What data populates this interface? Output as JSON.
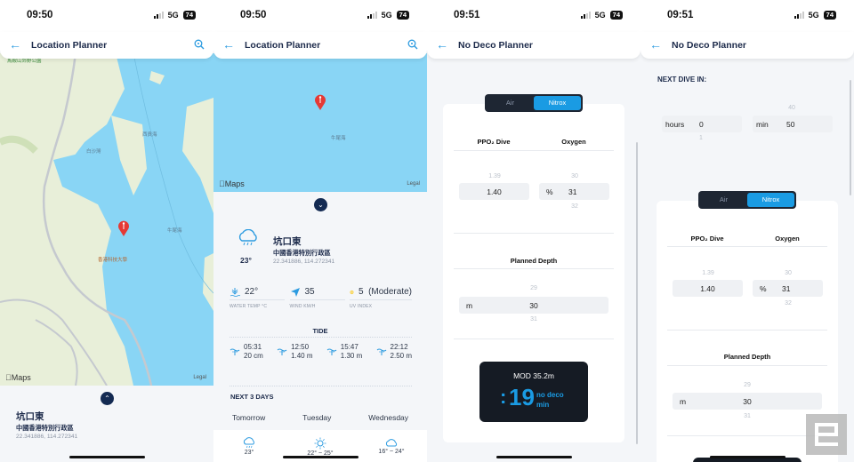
{
  "screens": [
    {
      "status": {
        "time": "09:50",
        "network": "5G",
        "battery": "74"
      },
      "header": {
        "title": "Location Planner"
      },
      "map": {
        "attribution": "Maps",
        "legal": "Legal",
        "labels": [
          "西貢海",
          "白沙灣",
          "牛尾海",
          "香港科技大學",
          "馬鞍山郊野公園"
        ]
      },
      "location": {
        "name": "坑口東",
        "region": "中國香港特別行政區",
        "coords": "22.341886, 114.272341"
      }
    },
    {
      "status": {
        "time": "09:50",
        "network": "5G",
        "battery": "74"
      },
      "header": {
        "title": "Location Planner"
      },
      "map": {
        "attribution": "Maps",
        "legal": "Legal",
        "labels": [
          "牛尾海"
        ]
      },
      "weather": {
        "temp": "23°",
        "icon": "rain-cloud-icon"
      },
      "location": {
        "name": "坑口東",
        "region": "中國香港特別行政區",
        "coords": "22.341886, 114.272341"
      },
      "stats": [
        {
          "icon": "water-temp-icon",
          "value": "22°",
          "label": "WATER TEMP °C"
        },
        {
          "icon": "wind-arrow-icon",
          "value": "35",
          "label": "WIND KM/H"
        },
        {
          "icon": "sun-icon",
          "value": "5  (Moderate)",
          "label": "UV INDEX"
        }
      ],
      "tide": {
        "title": "TIDE",
        "entries": [
          {
            "time": "05:31",
            "height": "20 cm"
          },
          {
            "time": "12:50",
            "height": "1.40 m"
          },
          {
            "time": "15:47",
            "height": "1.30 m"
          },
          {
            "time": "22:12",
            "height": "2.50 m"
          }
        ]
      },
      "forecast": {
        "title": "NEXT 3 DAYS",
        "days": [
          {
            "day": "Tomorrow",
            "icon": "rain-cloud-icon",
            "temp": "23°"
          },
          {
            "day": "Tuesday",
            "icon": "sun-icon",
            "temp": "22° ~ 25°"
          },
          {
            "day": "Wednesday",
            "icon": "cloud-icon",
            "temp": "16° ~ 24°"
          }
        ]
      }
    },
    {
      "status": {
        "time": "09:51",
        "network": "5G",
        "battery": "74"
      },
      "header": {
        "title": "No Deco Planner"
      },
      "gas_toggle": {
        "options": [
          "Air",
          "Nitrox"
        ],
        "selected": "Nitrox"
      },
      "columns": {
        "ppo2": "PPO₂ Dive",
        "oxygen": "Oxygen",
        "depth": "Planned Depth"
      },
      "ppo2": {
        "prev": "1.39",
        "value": "1.40"
      },
      "oxygen": {
        "unit": "%",
        "prev": "30",
        "value": "31",
        "next": "32"
      },
      "depth": {
        "unit": "m",
        "prev": "29",
        "value": "30",
        "next": "31"
      },
      "result": {
        "mod": "MOD 35.2m",
        "colon": ":",
        "minutes": "19",
        "label1": "no deco",
        "label2": "min"
      }
    },
    {
      "status": {
        "time": "09:51",
        "network": "5G",
        "battery": "74"
      },
      "header": {
        "title": "No Deco Planner"
      },
      "next_dive": {
        "title": "NEXT DIVE IN:",
        "hours": {
          "unit": "hours",
          "value": "0",
          "next": "1"
        },
        "minutes": {
          "unit": "min",
          "prev": "40",
          "value": "50"
        }
      },
      "gas_toggle": {
        "options": [
          "Air",
          "Nitrox"
        ],
        "selected": "Nitrox"
      },
      "columns": {
        "ppo2": "PPO₂ Dive",
        "oxygen": "Oxygen",
        "depth": "Planned Depth"
      },
      "ppo2": {
        "prev": "1.39",
        "value": "1.40"
      },
      "oxygen": {
        "unit": "%",
        "prev": "30",
        "value": "31",
        "next": "32"
      },
      "depth": {
        "unit": "m",
        "prev": "29",
        "value": "30",
        "next": "31"
      }
    }
  ],
  "colors": {
    "accent": "#1a9be3",
    "navy": "#1c2a4a",
    "water": "#89d5f5",
    "land": "#e8efd9",
    "pin": "#e53935"
  }
}
